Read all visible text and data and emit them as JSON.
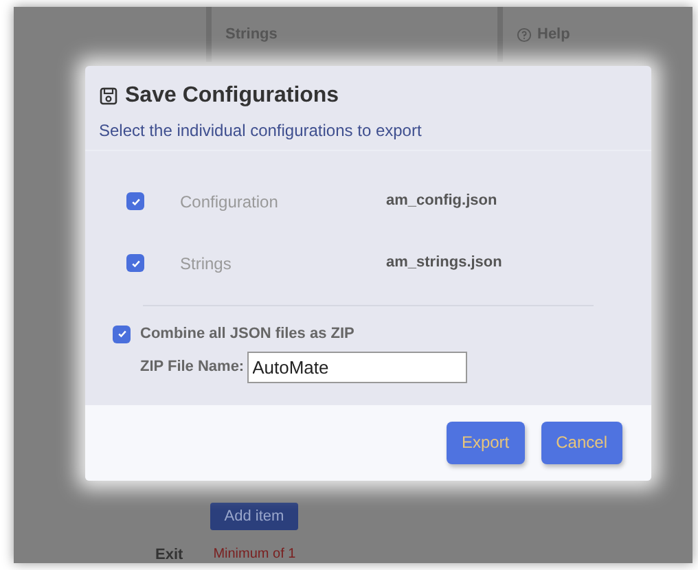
{
  "background": {
    "tabs": [
      {
        "label": "Strings",
        "kind": "text"
      },
      {
        "label": "Help",
        "kind": "help"
      }
    ],
    "add_button": "Add item",
    "exit_label": "Exit",
    "exit_note": "Minimum of 1"
  },
  "dialog": {
    "title": "Save Configurations",
    "subtitle": "Select the individual configurations to export",
    "files": [
      {
        "name": "Configuration",
        "file": "am_config.json",
        "checked": true
      },
      {
        "name": "Strings",
        "file": "am_strings.json",
        "checked": true
      }
    ],
    "combine": {
      "label": "Combine all JSON files as ZIP",
      "checked": true
    },
    "zip_name": {
      "label": "ZIP File Name:",
      "value": "AutoMate"
    },
    "buttons": [
      "Export",
      "Cancel"
    ]
  }
}
